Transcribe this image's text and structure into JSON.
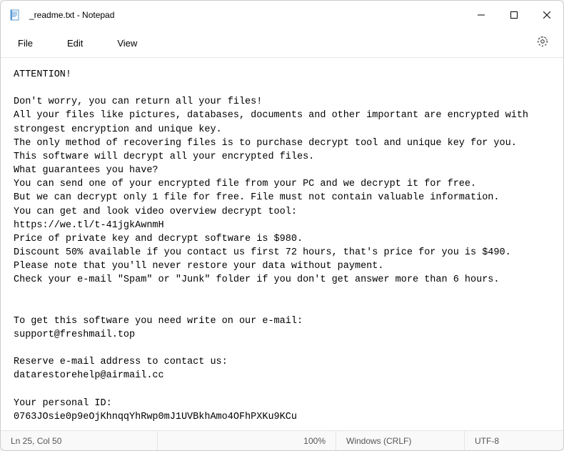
{
  "titlebar": {
    "title": "_readme.txt - Notepad"
  },
  "menubar": {
    "file": "File",
    "edit": "Edit",
    "view": "View"
  },
  "content": {
    "text": "ATTENTION!\n\nDon't worry, you can return all your files!\nAll your files like pictures, databases, documents and other important are encrypted with strongest encryption and unique key.\nThe only method of recovering files is to purchase decrypt tool and unique key for you.\nThis software will decrypt all your encrypted files.\nWhat guarantees you have?\nYou can send one of your encrypted file from your PC and we decrypt it for free.\nBut we can decrypt only 1 file for free. File must not contain valuable information.\nYou can get and look video overview decrypt tool:\nhttps://we.tl/t-41jgkAwnmH\nPrice of private key and decrypt software is $980.\nDiscount 50% available if you contact us first 72 hours, that's price for you is $490.\nPlease note that you'll never restore your data without payment.\nCheck your e-mail \"Spam\" or \"Junk\" folder if you don't get answer more than 6 hours.\n\n\nTo get this software you need write on our e-mail:\nsupport@freshmail.top\n\nReserve e-mail address to contact us:\ndatarestorehelp@airmail.cc\n\nYour personal ID:\n0763JOsie0p9eOjKhnqqYhRwp0mJ1UVBkhAmo4OFhPXKu9KCu"
  },
  "statusbar": {
    "cursor": "Ln 25, Col 50",
    "zoom": "100%",
    "eol": "Windows (CRLF)",
    "encoding": "UTF-8"
  }
}
